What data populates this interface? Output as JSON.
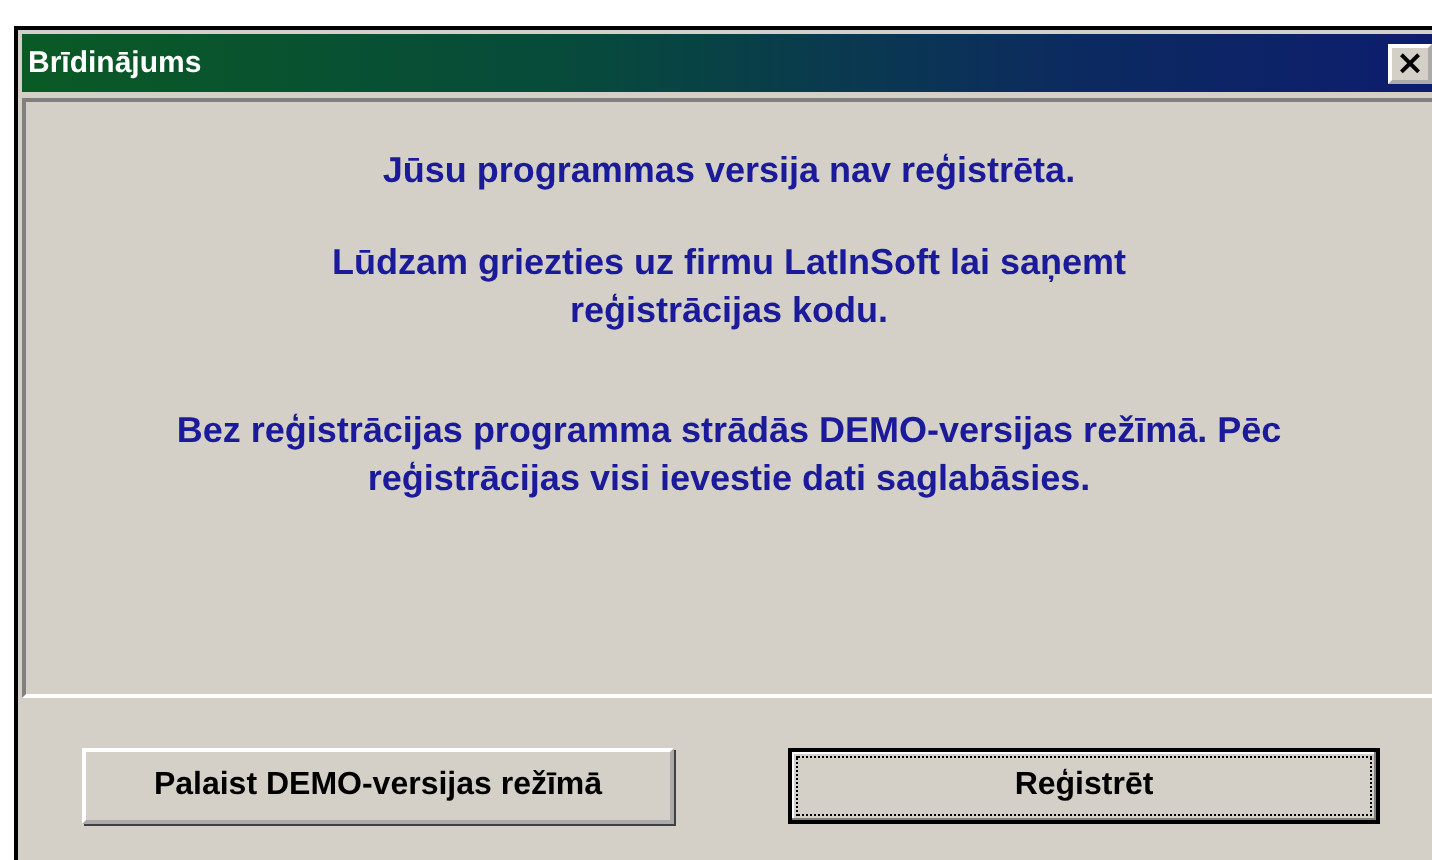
{
  "window": {
    "title": "Brīdinājums",
    "close_label": "×"
  },
  "messages": [
    "Jūsu programmas versija nav reģistrēta.",
    "Lūdzam griezties uz firmu LatInSoft lai saņemt reģistrācijas kodu.",
    "Bez reģistrācijas programma strādās DEMO-versijas režīmā. Pēc reģistrācijas visi ievestie dati saglabāsies."
  ],
  "buttons": [
    {
      "label": "Palaist DEMO-versijas režīmā",
      "default": false
    },
    {
      "label": "Reģistrēt",
      "default": true
    }
  ]
}
